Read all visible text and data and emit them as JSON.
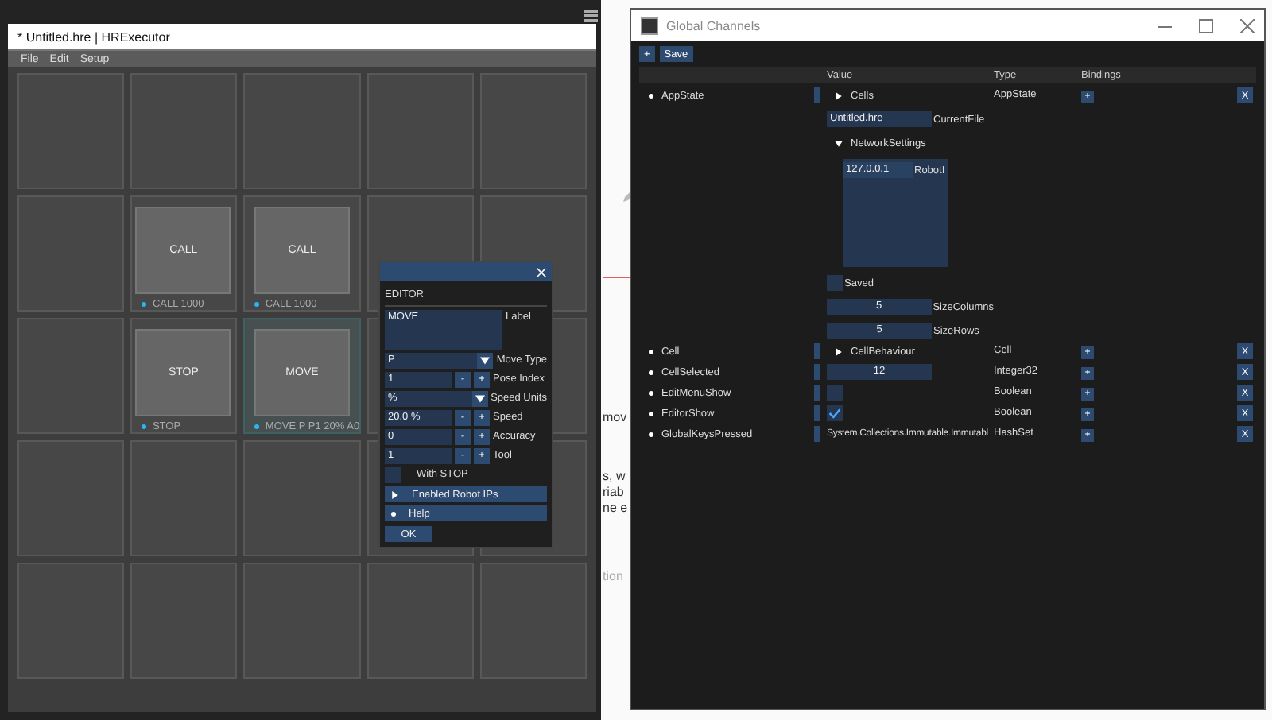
{
  "main_window": {
    "title": "* Untitled.hre | HRExecutor",
    "menu": [
      "File",
      "Edit",
      "Setup"
    ],
    "grid": [
      [
        {
          "selected": false
        },
        {
          "selected": false
        },
        {
          "selected": false
        },
        {
          "selected": false
        },
        {
          "selected": false
        }
      ],
      [
        {
          "selected": false
        },
        {
          "button": "CALL",
          "caption": "CALL  1000",
          "selected": false
        },
        {
          "button": "CALL",
          "caption": "CALL  1000",
          "selected": false
        },
        {
          "selected": false
        },
        {
          "selected": false
        }
      ],
      [
        {
          "selected": false
        },
        {
          "button": "STOP",
          "caption": "STOP",
          "selected": false
        },
        {
          "button": "MOVE",
          "caption": "MOVE P P1 20% A0",
          "selected": true
        },
        {
          "selected": false
        },
        {
          "selected": false
        }
      ],
      [
        {
          "selected": false
        },
        {
          "selected": false
        },
        {
          "selected": false
        },
        {
          "selected": false
        },
        {
          "selected": false
        }
      ],
      [
        {
          "selected": false
        },
        {
          "selected": false
        },
        {
          "selected": false
        },
        {
          "selected": false
        },
        {
          "selected": false
        }
      ]
    ]
  },
  "editor": {
    "heading": "EDITOR",
    "fields": [
      {
        "kind": "textarea",
        "value": "MOVE",
        "label": "Label"
      },
      {
        "kind": "dropdown",
        "value": "P",
        "label": "Move Type"
      },
      {
        "kind": "stepper",
        "value": "1",
        "minus": "-",
        "plus": "+",
        "label": "Pose Index"
      },
      {
        "kind": "dropdown",
        "value": "%",
        "label": "Speed Units"
      },
      {
        "kind": "stepper",
        "value": "20.0 %",
        "minus": "-",
        "plus": "+",
        "label": "Speed"
      },
      {
        "kind": "stepper",
        "value": "0",
        "minus": "-",
        "plus": "+",
        "label": "Accuracy"
      },
      {
        "kind": "stepper",
        "value": "1",
        "minus": "-",
        "plus": "+",
        "label": "Tool"
      },
      {
        "kind": "check",
        "label": "With STOP",
        "checked": false
      }
    ],
    "sections": [
      {
        "kind": "collapsed",
        "label": "Enabled Robot IPs"
      },
      {
        "kind": "bullet",
        "label": "Help"
      }
    ],
    "ok_button": "OK"
  },
  "background_page": {
    "fragments": [
      "mov",
      "s, w",
      "riab",
      "ne e",
      "tion"
    ]
  },
  "channels_window": {
    "title": "Global Channels",
    "toolbar": [
      "+",
      "Save"
    ],
    "columns": [
      "Value",
      "Type",
      "Bindings"
    ],
    "rows": [
      {
        "name": "AppState",
        "type": "AppState",
        "binding_button": "+",
        "delete_button": "X",
        "value": {
          "kind": "object",
          "members": [
            {
              "kind": "node",
              "label": "Cells",
              "expanded": false
            },
            {
              "kind": "text",
              "value": "Untitled.hre",
              "name": "CurrentFile"
            },
            {
              "kind": "node",
              "label": "NetworkSettings",
              "expanded": true,
              "members": [
                {
                  "kind": "text",
                  "value": "127.0.0.1",
                  "name": "RobotI"
                }
              ]
            },
            {
              "kind": "check",
              "label": "Saved",
              "checked": false
            },
            {
              "kind": "number",
              "value": "5",
              "name": "SizeColumns"
            },
            {
              "kind": "number",
              "value": "5",
              "name": "SizeRows"
            }
          ]
        }
      },
      {
        "name": "Cell",
        "type": "Cell",
        "binding_button": "+",
        "delete_button": "X",
        "value": {
          "kind": "node",
          "label": "CellBehaviour",
          "expanded": false
        }
      },
      {
        "name": "CellSelected",
        "type": "Integer32",
        "binding_button": "+",
        "delete_button": "X",
        "value": {
          "kind": "number",
          "value": "12"
        }
      },
      {
        "name": "EditMenuShow",
        "type": "Boolean",
        "binding_button": "+",
        "delete_button": "X",
        "value": {
          "kind": "check",
          "checked": false
        }
      },
      {
        "name": "EditorShow",
        "type": "Boolean",
        "binding_button": "+",
        "delete_button": "X",
        "value": {
          "kind": "check",
          "checked": true
        }
      },
      {
        "name": "GlobalKeysPressed",
        "type": "HashSet",
        "binding_button": "+",
        "delete_button": "X",
        "value": {
          "kind": "plain",
          "value": "System.Collections.Immutable.Immutabl"
        }
      }
    ]
  }
}
